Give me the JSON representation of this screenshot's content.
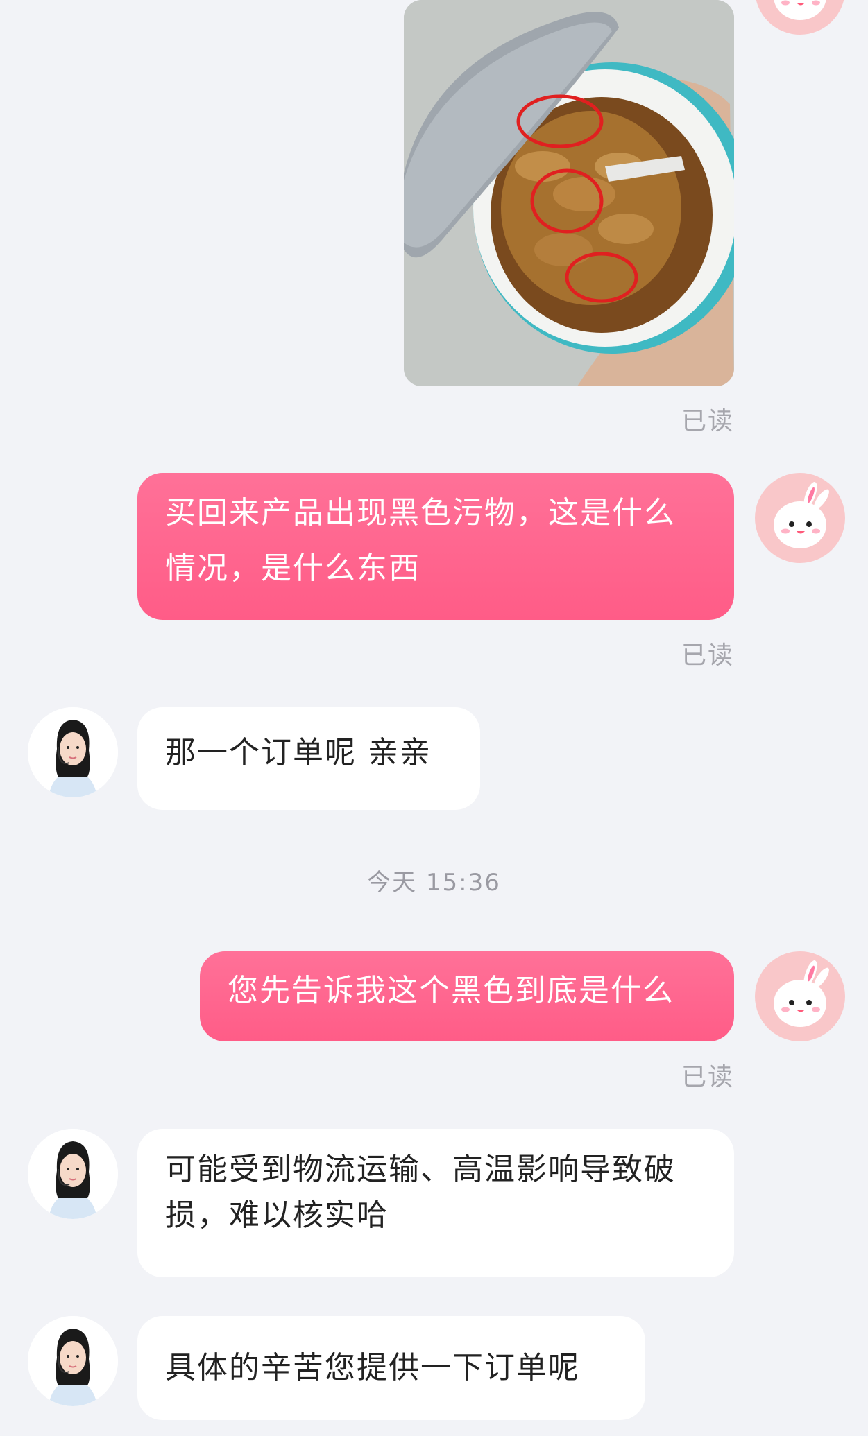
{
  "messages": {
    "m1": {
      "read": "已读"
    },
    "m2": {
      "text": "买回来产品出现黑色污物，这是什么情况，是什么东西",
      "read": "已读"
    },
    "m3": {
      "text": "那一个订单呢 亲亲"
    },
    "timestamp": "今天 15:36",
    "m4": {
      "text": "您先告诉我这个黑色到底是什么",
      "read": "已读"
    },
    "m5": {
      "text": "可能受到物流运输、高温影响导致破损，难以核实哈"
    },
    "m6": {
      "text": "具体的辛苦您提供一下订单呢"
    }
  },
  "colors": {
    "background": "#f2f3f7",
    "outgoing_bubble": "#ff6690",
    "incoming_bubble": "#ffffff",
    "read_receipt": "#a6a6ad"
  },
  "icons": {
    "user_avatar": "bunny-avatar-icon",
    "agent_avatar": "customer-service-agent-avatar"
  }
}
